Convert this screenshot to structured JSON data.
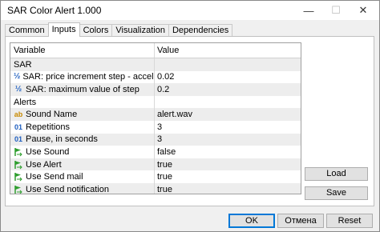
{
  "window": {
    "title": "SAR Color Alert 1.000",
    "minimize_glyph": "—",
    "maximize_glyph": "☐",
    "close_glyph": "✕"
  },
  "tabs": [
    {
      "label": "Common"
    },
    {
      "label": "Inputs"
    },
    {
      "label": "Colors"
    },
    {
      "label": "Visualization"
    },
    {
      "label": "Dependencies"
    }
  ],
  "grid": {
    "header": {
      "variable": "Variable",
      "value": "Value"
    },
    "rows": [
      {
        "type": "group",
        "label": "SAR",
        "value": ""
      },
      {
        "type": "param",
        "icon": "fraction-icon",
        "label": "SAR: price increment step - acceleration...",
        "value": "0.02"
      },
      {
        "type": "param",
        "icon": "fraction-icon",
        "label": "SAR: maximum value of step",
        "value": "0.2"
      },
      {
        "type": "group",
        "label": "Alerts",
        "value": ""
      },
      {
        "type": "param",
        "icon": "string-icon",
        "label": "Sound Name",
        "value": "alert.wav"
      },
      {
        "type": "param",
        "icon": "integer-icon",
        "label": "Repetitions",
        "value": "3"
      },
      {
        "type": "param",
        "icon": "integer-icon",
        "label": "Pause, in seconds",
        "value": "3"
      },
      {
        "type": "param",
        "icon": "bool-icon",
        "label": "Use Sound",
        "value": "false"
      },
      {
        "type": "param",
        "icon": "bool-icon",
        "label": "Use Alert",
        "value": "true"
      },
      {
        "type": "param",
        "icon": "bool-icon",
        "label": "Use Send mail",
        "value": "true"
      },
      {
        "type": "param",
        "icon": "bool-icon",
        "label": "Use Send notification",
        "value": "true"
      }
    ]
  },
  "icons": {
    "fraction": "½",
    "string": "ab",
    "integer": "01"
  },
  "buttons": {
    "load": "Load",
    "save": "Save",
    "ok": "OK",
    "cancel": "Отмена",
    "reset": "Reset"
  },
  "colors": {
    "accent": "#0078d7",
    "bool_icon": "#2e9e2e"
  }
}
